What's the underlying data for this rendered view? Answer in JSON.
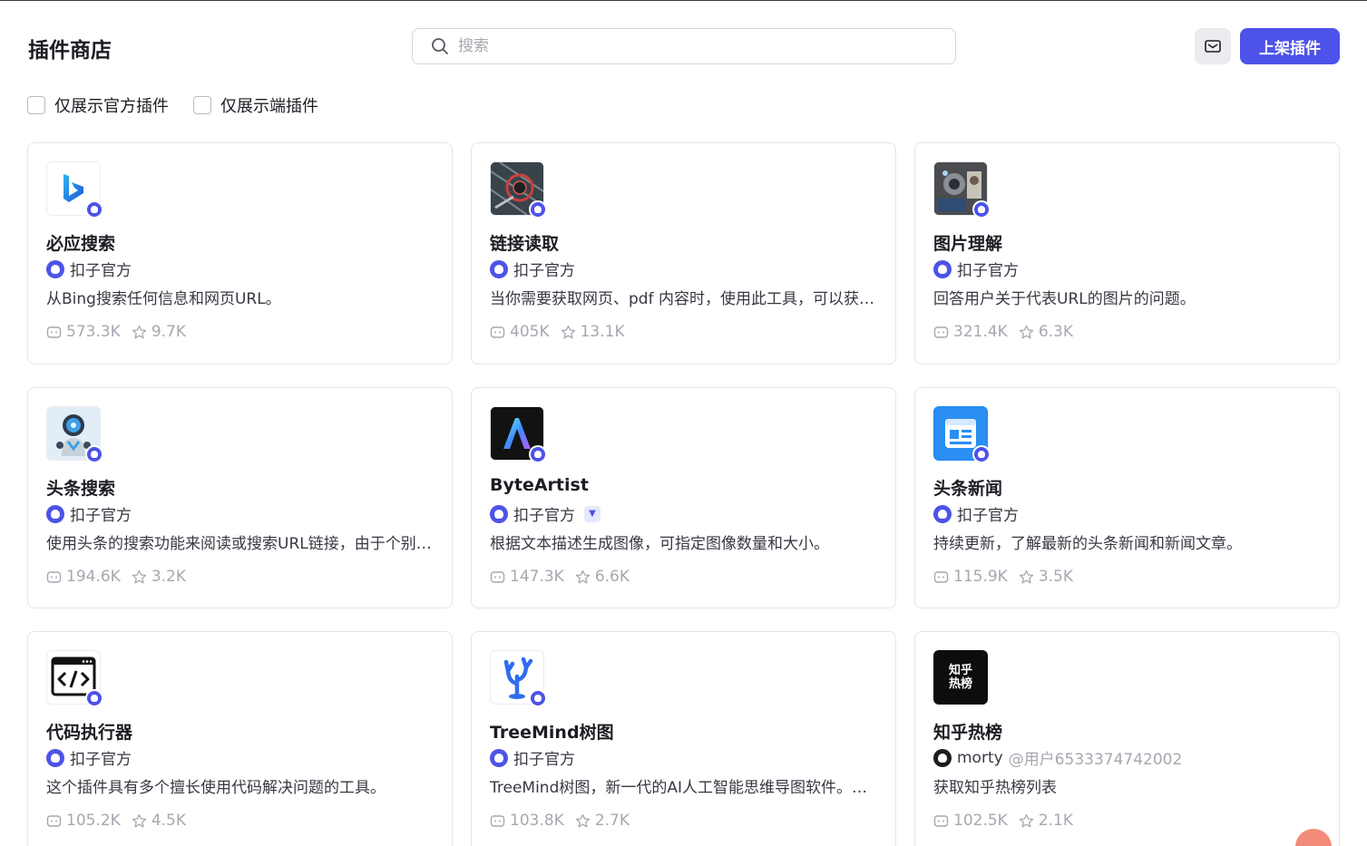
{
  "header": {
    "title": "插件商店",
    "search_placeholder": "搜索",
    "publish_label": "上架插件",
    "mail_icon": "mail-icon"
  },
  "filters": [
    {
      "label": "仅展示官方插件",
      "checked": false
    },
    {
      "label": "仅展示端插件",
      "checked": false
    }
  ],
  "colors": {
    "accent": "#4d53e8",
    "muted": "#a6a8b0",
    "border": "#e4e5ea"
  },
  "plugins": [
    {
      "name": "必应搜索",
      "author": "扣子官方",
      "desc": "从Bing搜索任何信息和网页URL。",
      "uses": "573.3K",
      "favs": "9.7K",
      "icon": "bing-logo-icon"
    },
    {
      "name": "链接读取",
      "author": "扣子官方",
      "desc": "当你需要获取网页、pdf 内容时，使用此工具，可以获取url链接下的标题和内容。",
      "uses": "405K",
      "favs": "13.1K",
      "icon": "link-reader-icon"
    },
    {
      "name": "图片理解",
      "author": "扣子官方",
      "desc": "回答用户关于代表URL的图片的问题。",
      "uses": "321.4K",
      "favs": "6.3K",
      "icon": "image-understand-icon"
    },
    {
      "name": "头条搜索",
      "author": "扣子官方",
      "desc": "使用头条的搜索功能来阅读或搜索URL链接，由于个别网站会限制访问，",
      "uses": "194.6K",
      "favs": "3.2K",
      "icon": "robot-icon"
    },
    {
      "name": "ByteArtist",
      "author": "扣子官方",
      "desc": "根据文本描述生成图像，可指定图像数量和大小。",
      "uses": "147.3K",
      "favs": "6.6K",
      "icon": "byteartist-logo-icon",
      "verified": true
    },
    {
      "name": "头条新闻",
      "author": "扣子官方",
      "desc": "持续更新，了解最新的头条新闻和新闻文章。",
      "uses": "115.9K",
      "favs": "3.5K",
      "icon": "news-icon"
    },
    {
      "name": "代码执行器",
      "author": "扣子官方",
      "desc": "这个插件具有多个擅长使用代码解决问题的工具。",
      "uses": "105.2K",
      "favs": "4.5K",
      "icon": "code-icon"
    },
    {
      "name": "TreeMind树图",
      "author": "扣子官方",
      "desc": "TreeMind树图，新一代的AI人工智能思维导图软件。支持一键生成思维导图",
      "uses": "103.8K",
      "favs": "2.7K",
      "icon": "treemind-logo-icon"
    },
    {
      "name": "知乎热榜",
      "author": "morty",
      "author_handle": "@用户6533374742002",
      "desc": "获取知乎热榜列表",
      "uses": "102.5K",
      "favs": "2.1K",
      "icon": "zhihu-hot-logo-icon",
      "icon_text": "知乎热榜",
      "third_party": true
    }
  ]
}
